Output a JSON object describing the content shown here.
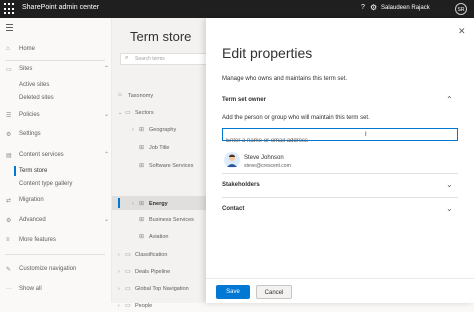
{
  "app": {
    "title": "SharePoint admin center",
    "user_name": "Salaudeen Rajack",
    "user_initials": "SR",
    "icons": [
      "waffle-icon",
      "gear-icon",
      "help-icon"
    ]
  },
  "leftnav": {
    "items": [
      {
        "label": "Home",
        "icon": "home-icon"
      },
      {
        "label": "Sites",
        "icon": "sites-icon"
      },
      {
        "label": "Policies",
        "icon": "policies-icon"
      },
      {
        "label": "Settings",
        "icon": "settings-icon"
      },
      {
        "label": "Content services",
        "icon": "content-services-icon"
      },
      {
        "label": "Migration",
        "icon": "migration-icon"
      },
      {
        "label": "Advanced",
        "icon": "advanced-icon"
      },
      {
        "label": "More features",
        "icon": "more-features-icon"
      },
      {
        "label": "Customize navigation",
        "icon": "edit-icon"
      },
      {
        "label": "Show all",
        "icon": "ellipsis-icon"
      }
    ],
    "sites_sub": [
      "Active sites",
      "Deleted sites"
    ],
    "content_sub": [
      "Term store",
      "Content type gallery"
    ]
  },
  "termstore": {
    "title": "Term store",
    "search_placeholder": "Search terms",
    "tree": [
      {
        "label": "Taxonomy"
      },
      {
        "label": "Sectors"
      },
      {
        "label": "Geography"
      },
      {
        "label": "Job Title"
      },
      {
        "label": "Software Services"
      },
      {
        "label": "Energy"
      },
      {
        "label": "Business Services"
      },
      {
        "label": "Aviation"
      },
      {
        "label": "Classification"
      },
      {
        "label": "Deals Pipeline"
      },
      {
        "label": "Global Top Navigation"
      },
      {
        "label": "People"
      }
    ]
  },
  "panel": {
    "title": "Edit properties",
    "description": "Manage who owns and maintains this term set.",
    "owner_section": {
      "title": "Term set owner",
      "description": "Add the person or group who will maintain this term set.",
      "input_placeholder": "Enter a name or email address"
    },
    "person": {
      "name": "Steve Johnson",
      "email": "steve@crescent.com"
    },
    "stakeholders_title": "Stakeholders",
    "contact_title": "Contact",
    "save_label": "Save",
    "cancel_label": "Cancel"
  },
  "colors": {
    "accent": "#0078d4",
    "topbar": "#1f1f1f"
  }
}
